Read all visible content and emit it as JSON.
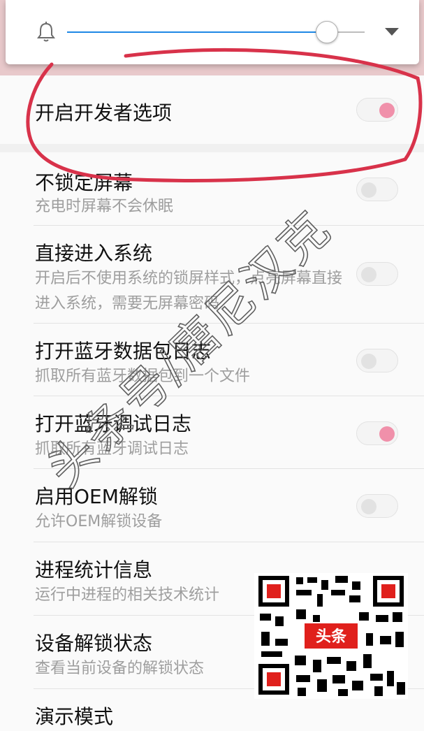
{
  "volume": {
    "level": 0.9
  },
  "developer_master": {
    "title": "开启开发者选项",
    "enabled": true
  },
  "settings": [
    {
      "title": "不锁定屏幕",
      "summary": "充电时屏幕不会休眠",
      "enabled": false
    },
    {
      "title": "直接进入系统",
      "summary": "开启后不使用系统的锁屏样式，点亮屏幕直接进入系统，需要无屏幕密码",
      "enabled": false
    },
    {
      "title": "打开蓝牙数据包日志",
      "summary": "抓取所有蓝牙数据包到一个文件",
      "enabled": false
    },
    {
      "title": "打开蓝牙调试日志",
      "summary": "抓取所有蓝牙调试日志",
      "enabled": true
    },
    {
      "title": "启用OEM解锁",
      "summary": "允许OEM解锁设备",
      "enabled": false
    },
    {
      "title": "进程统计信息",
      "summary": "运行中进程的相关技术统计"
    },
    {
      "title": "设备解锁状态",
      "summary": "查看当前设备的解锁状态"
    },
    {
      "title": "演示模式"
    }
  ],
  "watermark": {
    "text": "头条号/唐尼汉克"
  },
  "qr_badge": {
    "text": "头条"
  },
  "colors": {
    "accent_on": "#f090aa",
    "annotation_red": "#d8324a",
    "slider_blue": "#1e88e5"
  }
}
